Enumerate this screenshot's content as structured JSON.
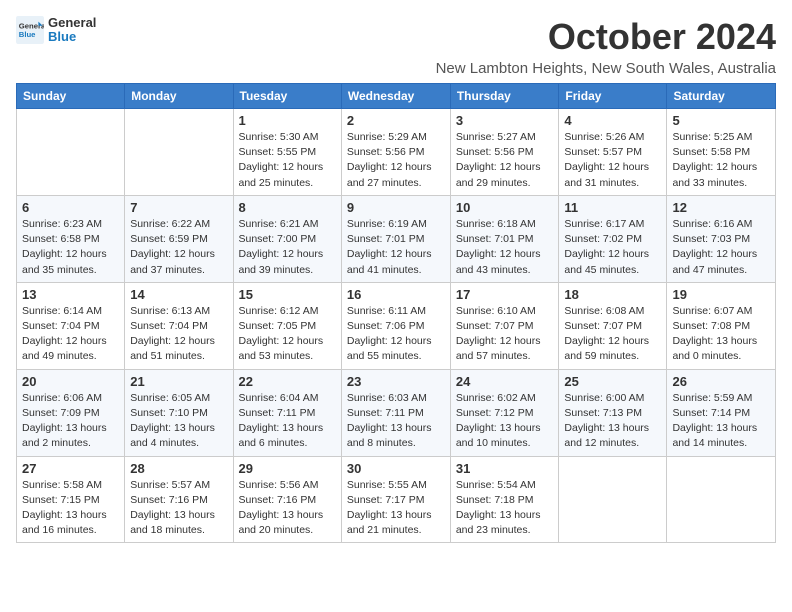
{
  "logo": {
    "text_general": "General",
    "text_blue": "Blue"
  },
  "title": "October 2024",
  "subtitle": "New Lambton Heights, New South Wales, Australia",
  "days_of_week": [
    "Sunday",
    "Monday",
    "Tuesday",
    "Wednesday",
    "Thursday",
    "Friday",
    "Saturday"
  ],
  "weeks": [
    [
      {
        "day": "",
        "info": ""
      },
      {
        "day": "",
        "info": ""
      },
      {
        "day": "1",
        "info": "Sunrise: 5:30 AM\nSunset: 5:55 PM\nDaylight: 12 hours\nand 25 minutes."
      },
      {
        "day": "2",
        "info": "Sunrise: 5:29 AM\nSunset: 5:56 PM\nDaylight: 12 hours\nand 27 minutes."
      },
      {
        "day": "3",
        "info": "Sunrise: 5:27 AM\nSunset: 5:56 PM\nDaylight: 12 hours\nand 29 minutes."
      },
      {
        "day": "4",
        "info": "Sunrise: 5:26 AM\nSunset: 5:57 PM\nDaylight: 12 hours\nand 31 minutes."
      },
      {
        "day": "5",
        "info": "Sunrise: 5:25 AM\nSunset: 5:58 PM\nDaylight: 12 hours\nand 33 minutes."
      }
    ],
    [
      {
        "day": "6",
        "info": "Sunrise: 6:23 AM\nSunset: 6:58 PM\nDaylight: 12 hours\nand 35 minutes."
      },
      {
        "day": "7",
        "info": "Sunrise: 6:22 AM\nSunset: 6:59 PM\nDaylight: 12 hours\nand 37 minutes."
      },
      {
        "day": "8",
        "info": "Sunrise: 6:21 AM\nSunset: 7:00 PM\nDaylight: 12 hours\nand 39 minutes."
      },
      {
        "day": "9",
        "info": "Sunrise: 6:19 AM\nSunset: 7:01 PM\nDaylight: 12 hours\nand 41 minutes."
      },
      {
        "day": "10",
        "info": "Sunrise: 6:18 AM\nSunset: 7:01 PM\nDaylight: 12 hours\nand 43 minutes."
      },
      {
        "day": "11",
        "info": "Sunrise: 6:17 AM\nSunset: 7:02 PM\nDaylight: 12 hours\nand 45 minutes."
      },
      {
        "day": "12",
        "info": "Sunrise: 6:16 AM\nSunset: 7:03 PM\nDaylight: 12 hours\nand 47 minutes."
      }
    ],
    [
      {
        "day": "13",
        "info": "Sunrise: 6:14 AM\nSunset: 7:04 PM\nDaylight: 12 hours\nand 49 minutes."
      },
      {
        "day": "14",
        "info": "Sunrise: 6:13 AM\nSunset: 7:04 PM\nDaylight: 12 hours\nand 51 minutes."
      },
      {
        "day": "15",
        "info": "Sunrise: 6:12 AM\nSunset: 7:05 PM\nDaylight: 12 hours\nand 53 minutes."
      },
      {
        "day": "16",
        "info": "Sunrise: 6:11 AM\nSunset: 7:06 PM\nDaylight: 12 hours\nand 55 minutes."
      },
      {
        "day": "17",
        "info": "Sunrise: 6:10 AM\nSunset: 7:07 PM\nDaylight: 12 hours\nand 57 minutes."
      },
      {
        "day": "18",
        "info": "Sunrise: 6:08 AM\nSunset: 7:07 PM\nDaylight: 12 hours\nand 59 minutes."
      },
      {
        "day": "19",
        "info": "Sunrise: 6:07 AM\nSunset: 7:08 PM\nDaylight: 13 hours\nand 0 minutes."
      }
    ],
    [
      {
        "day": "20",
        "info": "Sunrise: 6:06 AM\nSunset: 7:09 PM\nDaylight: 13 hours\nand 2 minutes."
      },
      {
        "day": "21",
        "info": "Sunrise: 6:05 AM\nSunset: 7:10 PM\nDaylight: 13 hours\nand 4 minutes."
      },
      {
        "day": "22",
        "info": "Sunrise: 6:04 AM\nSunset: 7:11 PM\nDaylight: 13 hours\nand 6 minutes."
      },
      {
        "day": "23",
        "info": "Sunrise: 6:03 AM\nSunset: 7:11 PM\nDaylight: 13 hours\nand 8 minutes."
      },
      {
        "day": "24",
        "info": "Sunrise: 6:02 AM\nSunset: 7:12 PM\nDaylight: 13 hours\nand 10 minutes."
      },
      {
        "day": "25",
        "info": "Sunrise: 6:00 AM\nSunset: 7:13 PM\nDaylight: 13 hours\nand 12 minutes."
      },
      {
        "day": "26",
        "info": "Sunrise: 5:59 AM\nSunset: 7:14 PM\nDaylight: 13 hours\nand 14 minutes."
      }
    ],
    [
      {
        "day": "27",
        "info": "Sunrise: 5:58 AM\nSunset: 7:15 PM\nDaylight: 13 hours\nand 16 minutes."
      },
      {
        "day": "28",
        "info": "Sunrise: 5:57 AM\nSunset: 7:16 PM\nDaylight: 13 hours\nand 18 minutes."
      },
      {
        "day": "29",
        "info": "Sunrise: 5:56 AM\nSunset: 7:16 PM\nDaylight: 13 hours\nand 20 minutes."
      },
      {
        "day": "30",
        "info": "Sunrise: 5:55 AM\nSunset: 7:17 PM\nDaylight: 13 hours\nand 21 minutes."
      },
      {
        "day": "31",
        "info": "Sunrise: 5:54 AM\nSunset: 7:18 PM\nDaylight: 13 hours\nand 23 minutes."
      },
      {
        "day": "",
        "info": ""
      },
      {
        "day": "",
        "info": ""
      }
    ]
  ]
}
